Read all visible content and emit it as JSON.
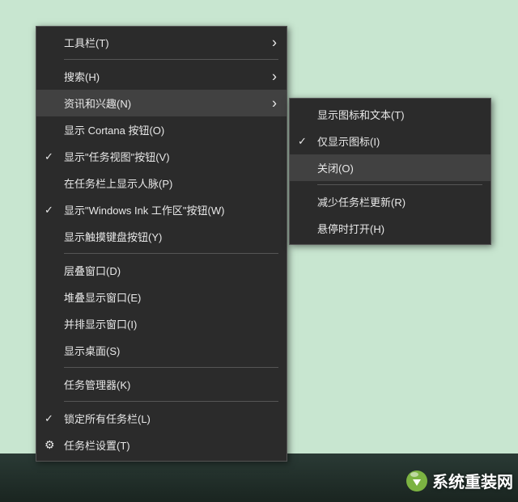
{
  "mainMenu": {
    "toolbars": "工具栏(T)",
    "search": "搜索(H)",
    "newsInterests": "资讯和兴趣(N)",
    "showCortana": "显示 Cortana 按钮(O)",
    "showTaskView": "显示\"任务视图\"按钮(V)",
    "showPeople": "在任务栏上显示人脉(P)",
    "showInk": "显示\"Windows Ink 工作区\"按钮(W)",
    "showTouchKb": "显示触摸键盘按钮(Y)",
    "cascade": "层叠窗口(D)",
    "stacked": "堆叠显示窗口(E)",
    "sideBySide": "并排显示窗口(I)",
    "showDesktop": "显示桌面(S)",
    "taskManager": "任务管理器(K)",
    "lockAll": "锁定所有任务栏(L)",
    "settings": "任务栏设置(T)"
  },
  "subMenu": {
    "iconText": "显示图标和文本(T)",
    "iconOnly": "仅显示图标(I)",
    "close": "关闭(O)",
    "reduceUpdates": "减少任务栏更新(R)",
    "openHover": "悬停时打开(H)"
  },
  "watermark": {
    "text": "系统重装网"
  }
}
